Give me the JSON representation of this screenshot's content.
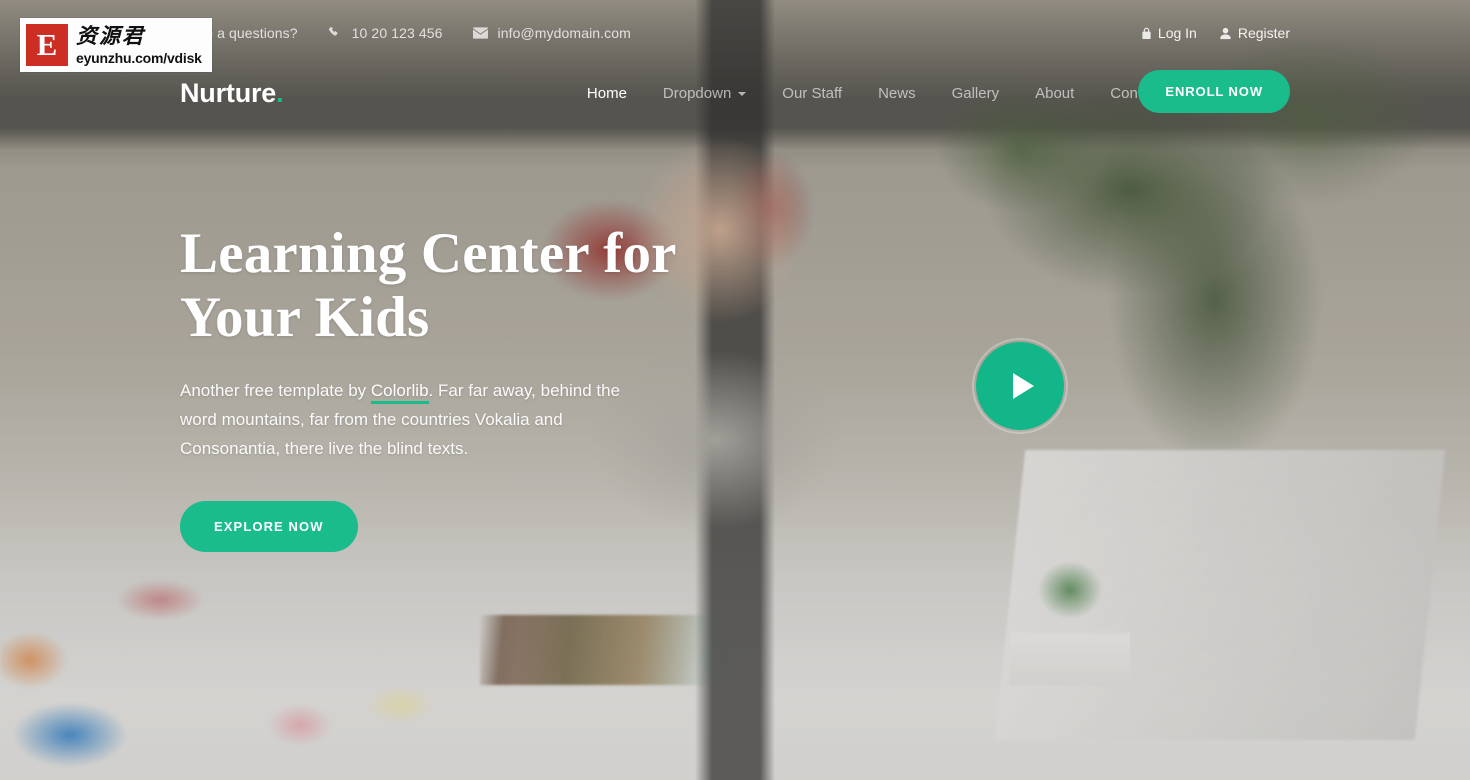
{
  "topbar": {
    "question_text": "Have a questions?",
    "phone": "10 20 123 456",
    "email": "info@mydomain.com",
    "phone_icon": "phone-icon",
    "email_icon": "envelope-icon",
    "login_label": "Log In",
    "login_icon": "lock-icon",
    "register_label": "Register",
    "register_icon": "user-icon"
  },
  "nav": {
    "brand": "Nurture",
    "brand_dot": ".",
    "items": [
      {
        "label": "Home",
        "active": true,
        "has_caret": false
      },
      {
        "label": "Dropdown",
        "active": false,
        "has_caret": true
      },
      {
        "label": "Our Staff",
        "active": false,
        "has_caret": false
      },
      {
        "label": "News",
        "active": false,
        "has_caret": false
      },
      {
        "label": "Gallery",
        "active": false,
        "has_caret": false
      },
      {
        "label": "About",
        "active": false,
        "has_caret": false
      },
      {
        "label": "Contact",
        "active": false,
        "has_caret": false
      }
    ],
    "enroll_label": "ENROLL NOW"
  },
  "hero": {
    "title_line1": "Learning Center for",
    "title_line2": "Your Kids",
    "sub_before": "Another free template by ",
    "sub_link": "Colorlib",
    "sub_after": ". Far far away, behind the word mountains, far from the countries Vokalia and Consonantia, there live the blind texts.",
    "explore_label": "EXPLORE NOW",
    "play_icon": "play-icon"
  },
  "watermark": {
    "badge_letter": "E",
    "brand_cn": "资源君",
    "url": "eyunzhu.com/vdisk"
  },
  "colors": {
    "accent_green": "#1abc8c",
    "play_green": "#13b689",
    "watermark_red": "#cc2e24",
    "nav_text": "#ffffff",
    "nav_text_muted": "rgba(255,255,255,.62)"
  }
}
